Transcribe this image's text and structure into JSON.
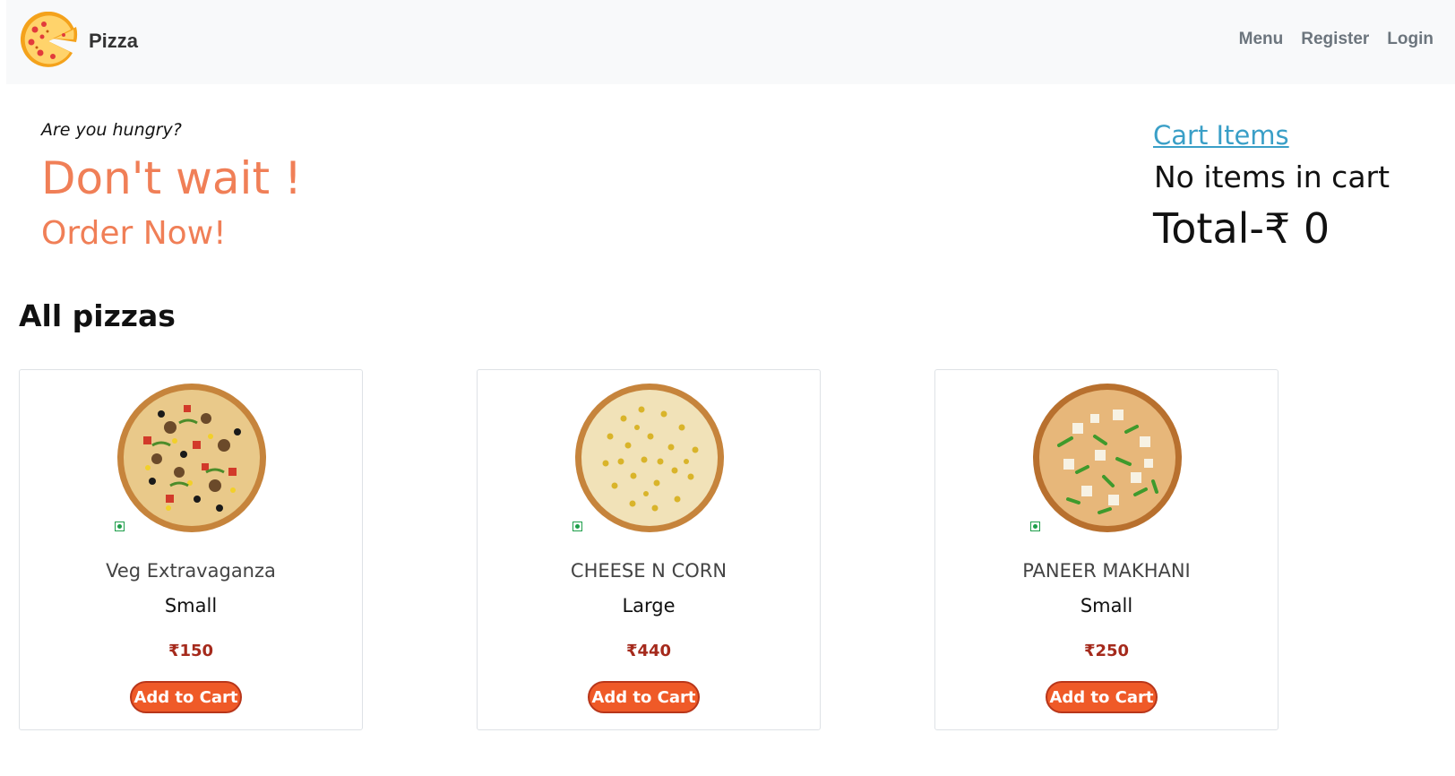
{
  "navbar": {
    "brand": "Pizza",
    "links": [
      "Menu",
      "Register",
      "Login"
    ]
  },
  "hero": {
    "tagline": "Are you hungry?",
    "title": "Don't wait !",
    "subtitle": "Order Now!"
  },
  "cart": {
    "link_label": "Cart Items",
    "empty_text": "No items in cart",
    "total_label": "Total-₹ 0"
  },
  "section": {
    "title": "All pizzas"
  },
  "pizzas": [
    {
      "name": "Veg Extravaganza",
      "size": "Small",
      "price": "₹150",
      "button": "Add to Cart",
      "image": "veg-extravaganza-pizza-image"
    },
    {
      "name": "CHEESE N CORN",
      "size": "Large",
      "price": "₹440",
      "button": "Add to Cart",
      "image": "cheese-corn-pizza-image"
    },
    {
      "name": "PANEER MAKHANI",
      "size": "Small",
      "price": "₹250",
      "button": "Add to Cart",
      "image": "paneer-makhani-pizza-image"
    }
  ],
  "colors": {
    "accent": "#f07f57",
    "button": "#ef5a28",
    "price": "#a52a1c",
    "link": "#3a9fc7",
    "veg": "#1e9e4a"
  }
}
